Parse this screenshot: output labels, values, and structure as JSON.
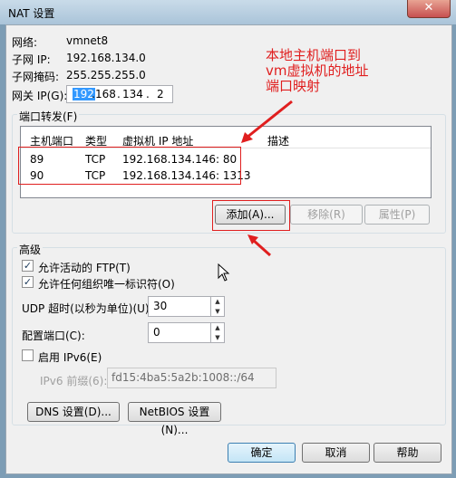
{
  "window": {
    "title": "NAT 设置",
    "close_glyph": "✕"
  },
  "info": {
    "network_label": "网络:",
    "network_value": "vmnet8",
    "subnet_ip_label": "子网 IP:",
    "subnet_ip_value": "192.168.134.0",
    "subnet_mask_label": "子网掩码:",
    "subnet_mask_value": "255.255.255.0",
    "gateway_label": "网关 IP(G):",
    "gateway_ip": [
      "192",
      "168",
      "134",
      "2"
    ]
  },
  "port_forwarding": {
    "legend": "端口转发(F)",
    "columns": [
      "主机端口",
      "类型",
      "虚拟机 IP 地址",
      "描述"
    ],
    "rows": [
      {
        "port": "89",
        "type": "TCP",
        "ip": "192.168.134.146: 80",
        "desc": ""
      },
      {
        "port": "90",
        "type": "TCP",
        "ip": "192.168.134.146: 1313",
        "desc": ""
      }
    ],
    "add_label": "添加(A)...",
    "remove_label": "移除(R)",
    "properties_label": "属性(P)"
  },
  "annotation": {
    "text": "本地主机端口到\nvm虚拟机的地址\n端口映射",
    "color": "#e01f1f"
  },
  "advanced": {
    "legend": "高级",
    "allow_ftp_label": "允许活动的 FTP(T)",
    "allow_ftp_checked": true,
    "allow_uid_label": "允许任何组织唯一标识符(O)",
    "allow_uid_checked": true,
    "udp_timeout_label": "UDP 超时(以秒为单位)(U):",
    "udp_timeout_value": "30",
    "config_port_label": "配置端口(C):",
    "config_port_value": "0",
    "ipv6_label": "启用 IPv6(E)",
    "ipv6_checked": false,
    "ipv6_prefix_label": "IPv6 前缀(6):",
    "ipv6_prefix_value": "fd15:4ba5:5a2b:1008::/64",
    "dns_button": "DNS 设置(D)...",
    "netbios_button": "NetBIOS 设置(N)..."
  },
  "footer": {
    "ok": "确定",
    "cancel": "取消",
    "help": "帮助"
  }
}
